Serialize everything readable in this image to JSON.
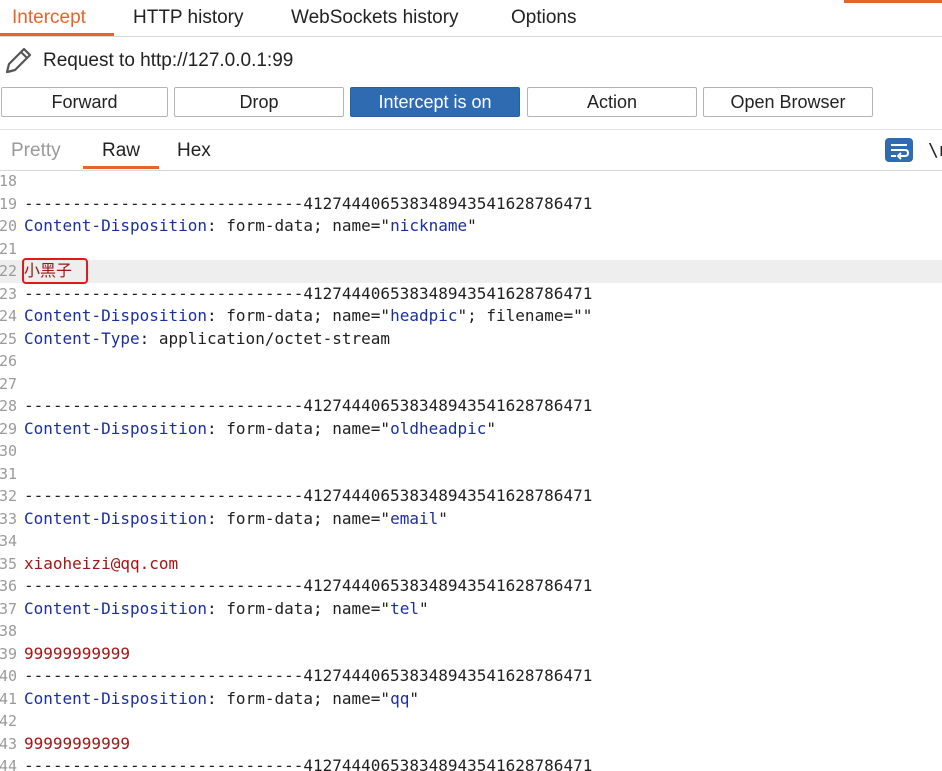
{
  "tabs": [
    "Intercept",
    "HTTP history",
    "WebSockets history",
    "Options"
  ],
  "request_title": "Request to http://127.0.0.1:99",
  "buttons": {
    "forward": "Forward",
    "drop": "Drop",
    "intercept": "Intercept is on",
    "action": "Action",
    "open_browser": "Open Browser"
  },
  "view_tabs": [
    "Pretty",
    "Raw",
    "Hex"
  ],
  "newline_label": "\\n",
  "boundary": "-----------------------------41274440653834894354162878647‌1",
  "lines": {
    "n18": "18",
    "n19": "19",
    "n20": "20",
    "n21": "21",
    "n22": "22",
    "n23": "23",
    "n24": "24",
    "n25": "25",
    "n26": "26",
    "n27": "27",
    "n28": "28",
    "n29": "29",
    "n30": "30",
    "n31": "31",
    "n32": "32",
    "n33": "33",
    "n34": "34",
    "n35": "35",
    "n36": "36",
    "n37": "37",
    "n38": "38",
    "n39": "39",
    "n40": "40",
    "n41": "41",
    "n42": "42",
    "n43": "43",
    "n44": "44"
  },
  "content": {
    "boundary": "-----------------------------412744406538348943541628786471",
    "cd_key": "Content-Disposition",
    "cd_val": ": form-data; name=\"",
    "ct_key": "Content-Type",
    "ct_val": ": application/octet-stream",
    "name_nickname": "nickname",
    "quote": "\"",
    "nickname_value": "小黑子",
    "name_headpic": "headpic",
    "filename_part": "\"; filename=\"\"",
    "name_oldheadpic": "oldheadpic",
    "name_email": "email",
    "email_value": "xiaoheizi@qq.com",
    "name_tel": "tel",
    "tel_value": "99999999999",
    "name_qq": "qq",
    "qq_value": "99999999999"
  },
  "colors": {
    "accent": "#e8632b",
    "primary_button": "#2e6bb1",
    "highlight_box": "#e0191b",
    "key_color": "#1a2fa0",
    "value_color": "#a31515"
  },
  "icons": [
    "pencil-icon",
    "wrap-lines-icon"
  ]
}
